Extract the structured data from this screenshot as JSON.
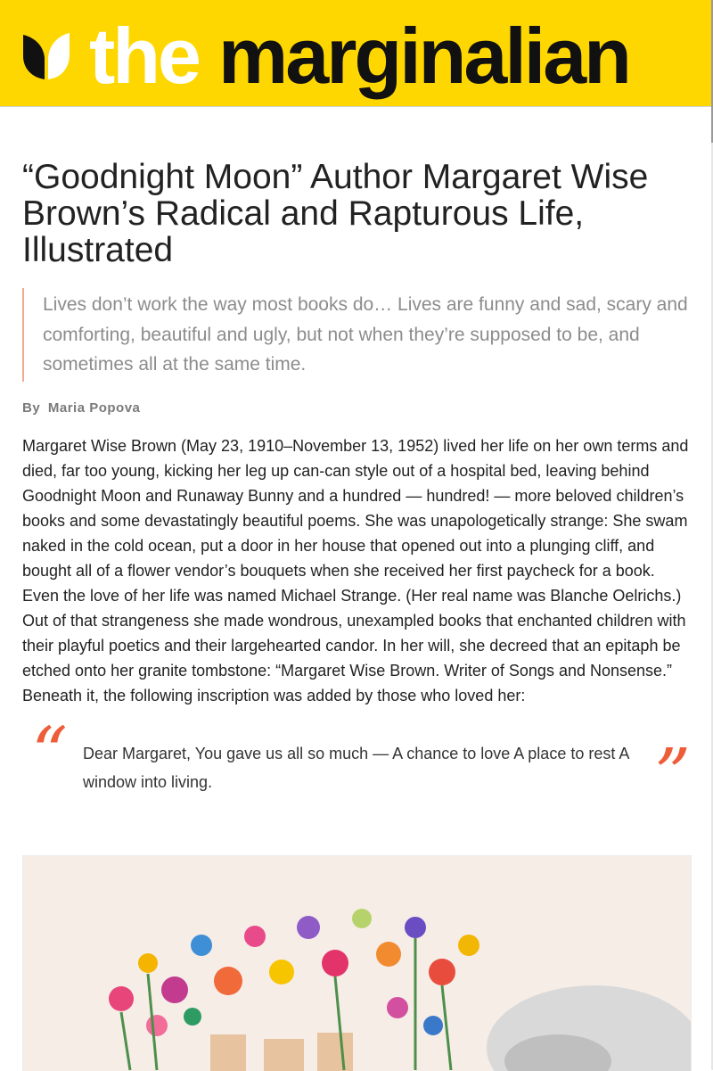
{
  "site": {
    "name_the": "the",
    "name_main": "marginalian",
    "brand_color": "#ffd700",
    "accent_color": "#ee5d3a"
  },
  "article": {
    "title": "“Goodnight Moon” Author Margaret Wise Brown’s Radical and Rapturous Life, Illustrated",
    "epigraph": "Lives don’t work the way most books do… Lives are funny and sad, scary and comforting, beautiful and ugly, but not when they’re supposed to be, and sometimes all at the same time.",
    "byline_prefix": "By",
    "author": "Maria Popova",
    "body": "Margaret Wise Brown (May 23, 1910–November 13, 1952) lived her life on her own terms and died, far too young, kicking her leg up can-can style out of a hospital bed, leaving behind Goodnight Moon and Runaway Bunny and a hundred — hundred! — more beloved children’s books and some devastatingly beautiful poems. She was unapologetically strange: She swam naked in the cold ocean, put a door in her house that opened out into a plunging cliff, and bought all of a flower vendor’s bouquets when she received her first paycheck for a book. Even the love of her life was named Michael Strange. (Her real name was Blanche Oelrichs.) Out of that strangeness she made wondrous, unexampled books that enchanted children with their playful poetics and their largehearted candor. In her will, she decreed that an epitaph be etched onto her granite tombstone: “Margaret Wise Brown. Writer of Songs and Nonsense.” Beneath it, the following inscription was added by those who loved her:",
    "quote": {
      "open_mark": "“",
      "close_mark": "”",
      "text": "Dear Margaret, You gave us all so much — A chance to love A place to rest A window into living."
    }
  },
  "illustration": {
    "icon": "flowers-illustration"
  }
}
